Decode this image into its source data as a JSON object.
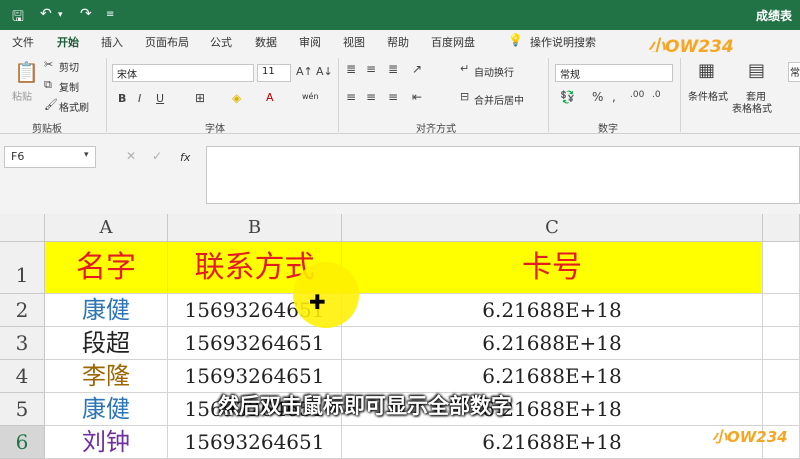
{
  "titlebar": {
    "save_icon": "save-icon",
    "undo_icon": "undo-icon",
    "redo_icon": "redo-icon",
    "customize_icon": "customize-qat-icon",
    "doc_title": "成绩表"
  },
  "menu": {
    "tabs": [
      "文件",
      "开始",
      "插入",
      "页面布局",
      "公式",
      "数据",
      "审阅",
      "视图",
      "帮助",
      "百度网盘"
    ],
    "active_index": 1,
    "tell_me": "操作说明搜索"
  },
  "ribbon": {
    "clipboard": {
      "paste": "粘贴",
      "cut": "剪切",
      "copy": "复制",
      "format_painter": "格式刷",
      "label": "剪贴板"
    },
    "font": {
      "name": "宋体",
      "size": "11",
      "label": "字体",
      "phonetic": "wén"
    },
    "alignment": {
      "wrap": "自动换行",
      "merge": "合并后居中",
      "label": "对齐方式"
    },
    "number": {
      "format": "常规",
      "label": "数字"
    },
    "styles": {
      "conditional": "条件格式",
      "table_format_1": "套用",
      "table_format_2": "表格格式",
      "cell_style": "常"
    }
  },
  "formula_bar": {
    "name_box": "F6",
    "fx": "fx"
  },
  "grid": {
    "columns": [
      "A",
      "B",
      "C"
    ],
    "rows": [
      "1",
      "2",
      "3",
      "4",
      "5",
      "6"
    ],
    "header": [
      "名字",
      "联系方式",
      "卡号"
    ],
    "data": [
      {
        "name": "康健",
        "name_color": "#2e75b6",
        "phone": "15693264651",
        "card": "6.21688E+18"
      },
      {
        "name": "段超",
        "name_color": "#222222",
        "phone": "15693264651",
        "card": "6.21688E+18"
      },
      {
        "name": "李隆",
        "name_color": "#9c6500",
        "phone": "15693264651",
        "card": "6.21688E+18"
      },
      {
        "name": "康健",
        "name_color": "#2e75b6",
        "phone": "15693264651",
        "card": "6.21688E+18"
      },
      {
        "name": "刘钟",
        "name_color": "#7030a0",
        "phone": "15693264651",
        "card": "6.21688E+18"
      }
    ]
  },
  "colors": {
    "header_fill": "#ffff00",
    "header_text": "#e31b23",
    "brand_green": "#217346"
  },
  "overlay": {
    "subtitle": "然后双击鼠标即可显示全部数字",
    "logo": "小OW234"
  }
}
